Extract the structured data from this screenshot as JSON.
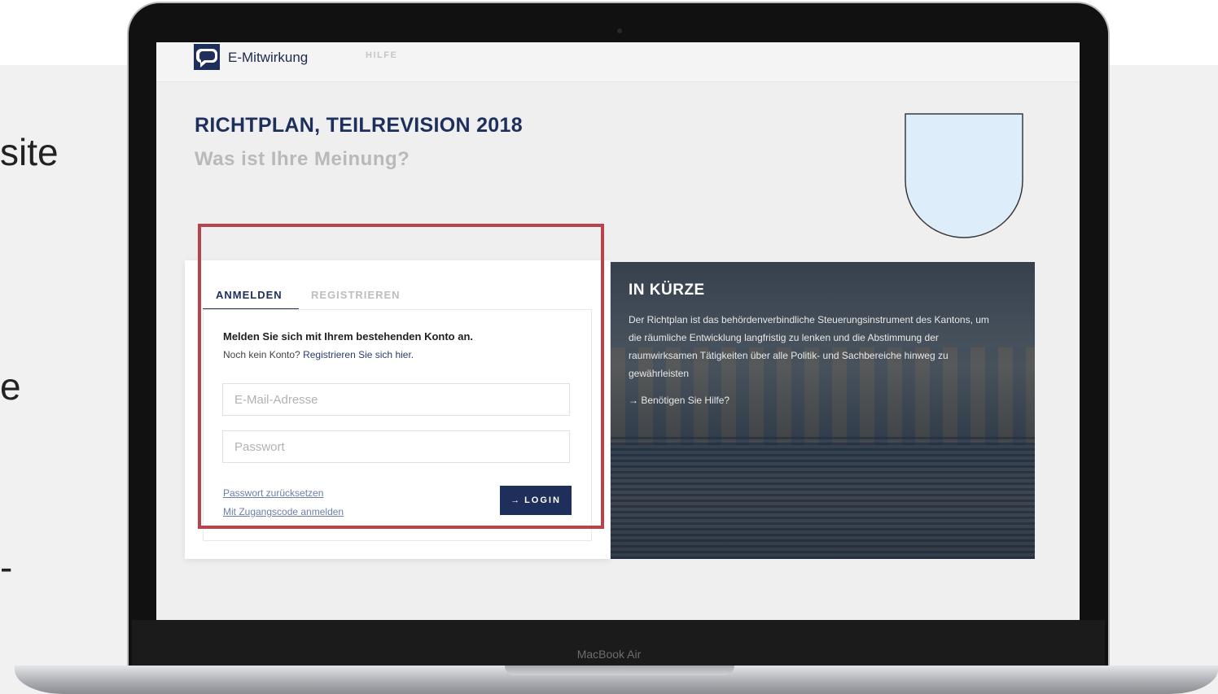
{
  "slide": {
    "text_fragments": [
      "site",
      "e",
      "-"
    ]
  },
  "laptop": {
    "model_label": "MacBook Air"
  },
  "header": {
    "logo_text": "E-Mitwirkung",
    "help_link": "HILFE"
  },
  "page": {
    "title": "RICHTPLAN, TEILREVISION 2018",
    "subtitle": "Was ist Ihre Meinung?"
  },
  "login": {
    "tabs": [
      {
        "label": "ANMELDEN",
        "active": true
      },
      {
        "label": "REGISTRIEREN",
        "active": false
      }
    ],
    "intro_bold": "Melden Sie sich mit Ihrem bestehenden Konto an.",
    "intro_prefix": "Noch kein Konto? ",
    "intro_link": "Registrieren Sie sich hier.",
    "email_placeholder": "E-Mail-Adresse",
    "password_placeholder": "Passwort",
    "reset_link": "Passwort zurücksetzen",
    "code_link": "Mit Zugangscode anmelden",
    "button_icon": "→",
    "button_label": "LOGIN"
  },
  "info": {
    "title": "IN KÜRZE",
    "text": "Der Richtplan ist das behördenverbindliche Steuerungsinstrument des Kantons, um die räumliche Entwicklung langfristig zu lenken und die Abstimmung der raumwirksamen Tätigkeiten über alle Politik- und Sachbereiche hinweg zu gewährleisten",
    "help_link": "→ Benötigen Sie Hilfe?"
  },
  "colors": {
    "brand_navy": "#1e2f5c",
    "highlight_red": "#b8434b",
    "crest_fill": "#ddeefa"
  }
}
